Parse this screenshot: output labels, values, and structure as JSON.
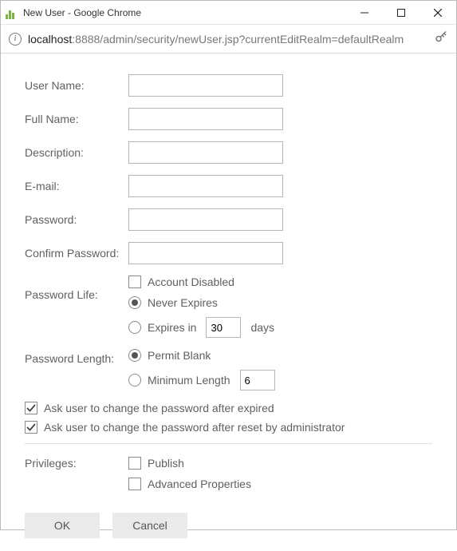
{
  "window": {
    "title": "New User - Google Chrome"
  },
  "address": {
    "host": "localhost",
    "path": ":8888/admin/security/newUser.jsp?currentEditRealm=defaultRealm"
  },
  "form": {
    "labels": {
      "userName": "User Name:",
      "fullName": "Full Name:",
      "description": "Description:",
      "email": "E-mail:",
      "password": "Password:",
      "confirmPassword": "Confirm Password:",
      "passwordLife": "Password Life:",
      "passwordLength": "Password Length:",
      "privileges": "Privileges:"
    },
    "values": {
      "userName": "",
      "fullName": "",
      "description": "",
      "email": "",
      "password": "",
      "confirmPassword": "",
      "expiresDays": "30",
      "minLength": "6"
    },
    "options": {
      "accountDisabled": "Account Disabled",
      "neverExpires": "Never Expires",
      "expiresInPrefix": "Expires in",
      "expiresInSuffix": "days",
      "permitBlank": "Permit Blank",
      "minimumLength": "Minimum Length",
      "askAfterExpired": "Ask user to change the password after expired",
      "askAfterReset": "Ask user to change the password after reset by administrator",
      "publish": "Publish",
      "advancedProperties": "Advanced Properties"
    },
    "buttons": {
      "ok": "OK",
      "cancel": "Cancel"
    }
  }
}
